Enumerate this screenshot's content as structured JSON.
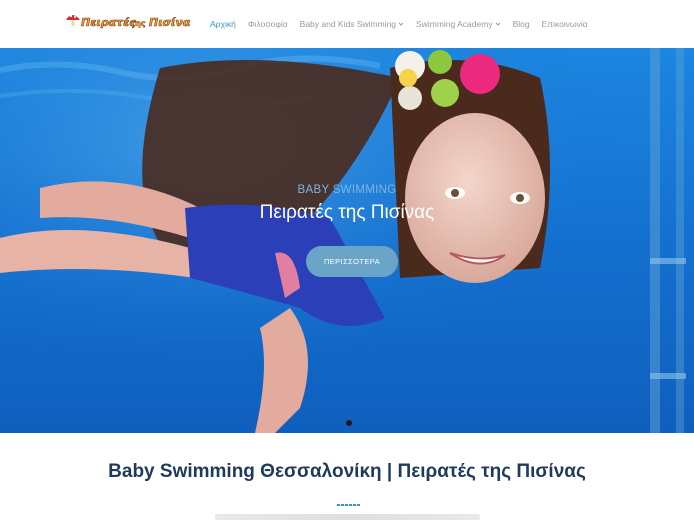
{
  "brand": {
    "logo_text": "Πειρατές της Πισίνας"
  },
  "nav": {
    "items": [
      {
        "label": "Αρχική",
        "active": true,
        "dropdown": false
      },
      {
        "label": "Φιλοσοφία",
        "active": false,
        "dropdown": false
      },
      {
        "label": "Baby and Kids Swimming",
        "active": false,
        "dropdown": true
      },
      {
        "label": "Swimming Academy",
        "active": false,
        "dropdown": true
      },
      {
        "label": "Blog",
        "active": false,
        "dropdown": false
      },
      {
        "label": "Επικοινωνία",
        "active": false,
        "dropdown": false
      }
    ]
  },
  "hero": {
    "kicker": "BABY SWIMMING",
    "title": "Πειρατές της Πισίνας",
    "button_label": "ΠΕΡΙΣΣΟΤΕΡΑ",
    "slide_index": 1,
    "slide_count": 1
  },
  "section": {
    "title": "Baby Swimming Θεσσαλονίκη | Πειρατές της Πισίνας"
  },
  "colors": {
    "accent": "#3a96c8",
    "water": "#1a6fcf",
    "button": "#6aa4c6",
    "heading": "#1f3a5a"
  }
}
